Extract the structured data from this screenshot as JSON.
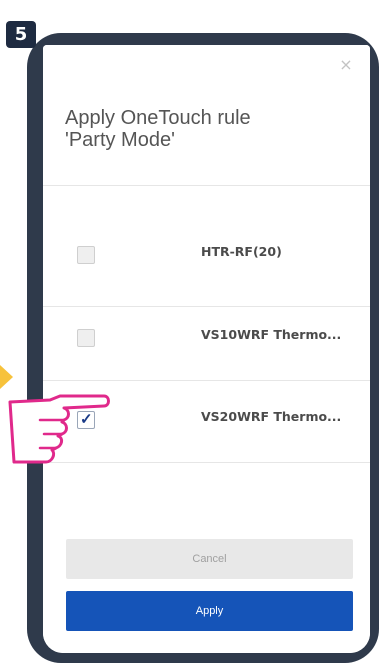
{
  "step": {
    "number": "5"
  },
  "modal": {
    "close_label": "×",
    "title_line1": "Apply OneTouch rule",
    "title_line2": "'Party Mode'"
  },
  "devices": [
    {
      "label": "HTR-RF(20)",
      "checked": false
    },
    {
      "label": "VS10WRF Thermo...",
      "checked": false
    },
    {
      "label": "VS20WRF Thermo...",
      "checked": true
    }
  ],
  "buttons": {
    "cancel_label": "Cancel",
    "apply_label": "Apply"
  },
  "icons": {
    "close": "close-icon",
    "hand": "pointing-hand-icon",
    "check": "checkmark-icon"
  },
  "colors": {
    "apply_button": "#1554b8",
    "cancel_button": "#e8e8e8",
    "phone_frame": "#2f3a4b",
    "step_badge": "#1e2b41",
    "hand_outline": "#e0298b",
    "arrow_hint": "#f7c23b"
  }
}
